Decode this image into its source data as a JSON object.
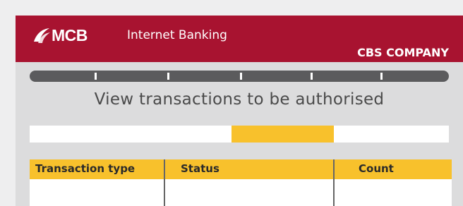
{
  "header": {
    "logo_text": "MCB",
    "app_title": "Internet Banking",
    "company": "CBS COMPANY"
  },
  "progress": {
    "steps": 5
  },
  "page": {
    "title": "View transactions to be authorised"
  },
  "table": {
    "columns": [
      "Transaction type",
      "Status",
      "Count"
    ],
    "rows": []
  },
  "colors": {
    "brand": "#a81330",
    "accent": "#f8c12c",
    "track": "#5b5b5d"
  }
}
